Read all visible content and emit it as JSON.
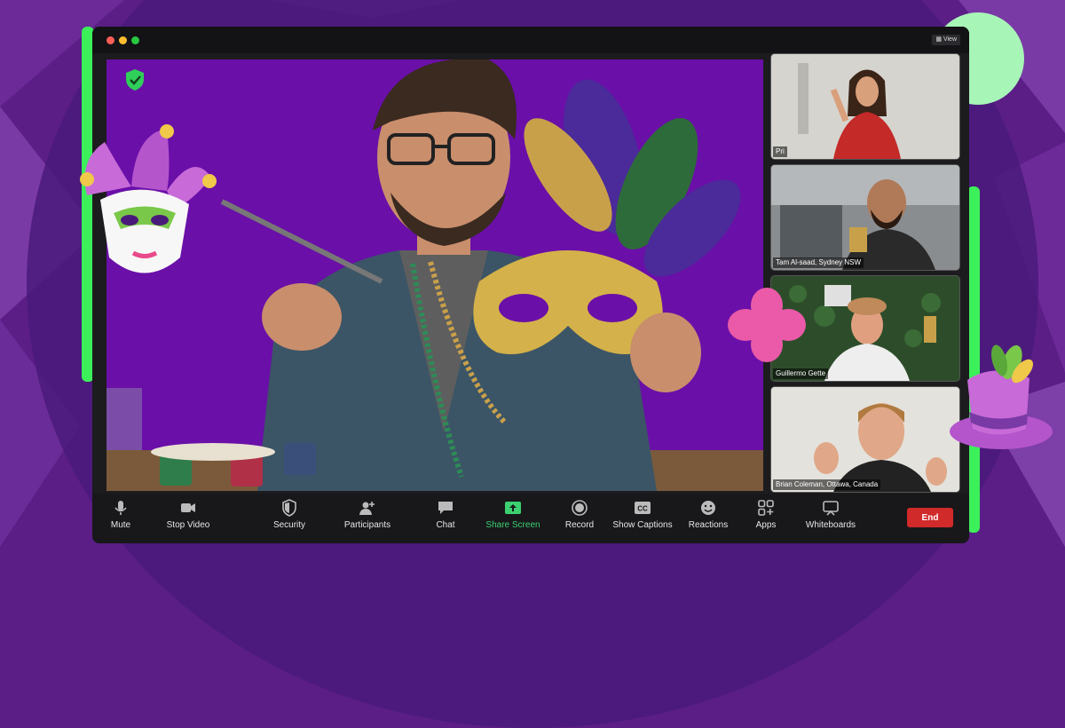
{
  "window": {
    "view_label": "View",
    "traffic_lights": [
      "#ff5f57",
      "#febc2e",
      "#28c840"
    ]
  },
  "colors": {
    "accent_green": "#3cf05a",
    "stage_purple": "#6a0fa8",
    "end_red": "#d12a2a",
    "share_green": "#3cd070"
  },
  "main_video": {
    "security_badge_icon": "shield-check-icon"
  },
  "participants": [
    {
      "name": "Pri"
    },
    {
      "name": "Tam Al-saad, Sydney NSW"
    },
    {
      "name": "Guillermo Gette"
    },
    {
      "name": "Brian Coleman, Ottawa, Canada"
    }
  ],
  "toolbar": {
    "items": [
      {
        "label": "Mute",
        "icon": "microphone-icon"
      },
      {
        "label": "Stop Video",
        "icon": "video-camera-icon"
      },
      {
        "label": "Security",
        "icon": "shield-icon"
      },
      {
        "label": "Participants",
        "icon": "participants-icon"
      },
      {
        "label": "Chat",
        "icon": "chat-icon"
      },
      {
        "label": "Share Screen",
        "icon": "share-screen-icon"
      },
      {
        "label": "Record",
        "icon": "record-icon"
      },
      {
        "label": "Show Captions",
        "icon": "captions-icon"
      },
      {
        "label": "Reactions",
        "icon": "reactions-icon"
      },
      {
        "label": "Apps",
        "icon": "apps-icon"
      },
      {
        "label": "Whiteboards",
        "icon": "whiteboard-icon"
      }
    ],
    "captions_glyph": "CC",
    "end_label": "End"
  }
}
